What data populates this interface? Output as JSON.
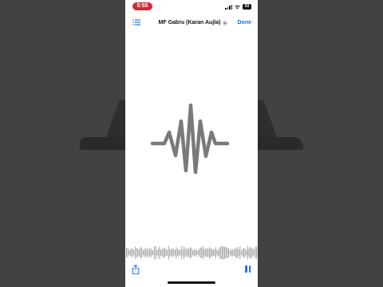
{
  "status_bar": {
    "time": "5:55",
    "battery": "93"
  },
  "nav": {
    "title": "MF Gabru (Karan Aujla)",
    "done_label": "Done"
  },
  "icons": {
    "list": "list-icon",
    "chevron": "chevron-down-circle-icon",
    "logo": "sound-wave-icon",
    "share": "share-icon",
    "pause": "pause-icon"
  },
  "colors": {
    "accent": "#1a73e8",
    "time_pill": "#d22a33",
    "wave": "#7a7a7a"
  }
}
